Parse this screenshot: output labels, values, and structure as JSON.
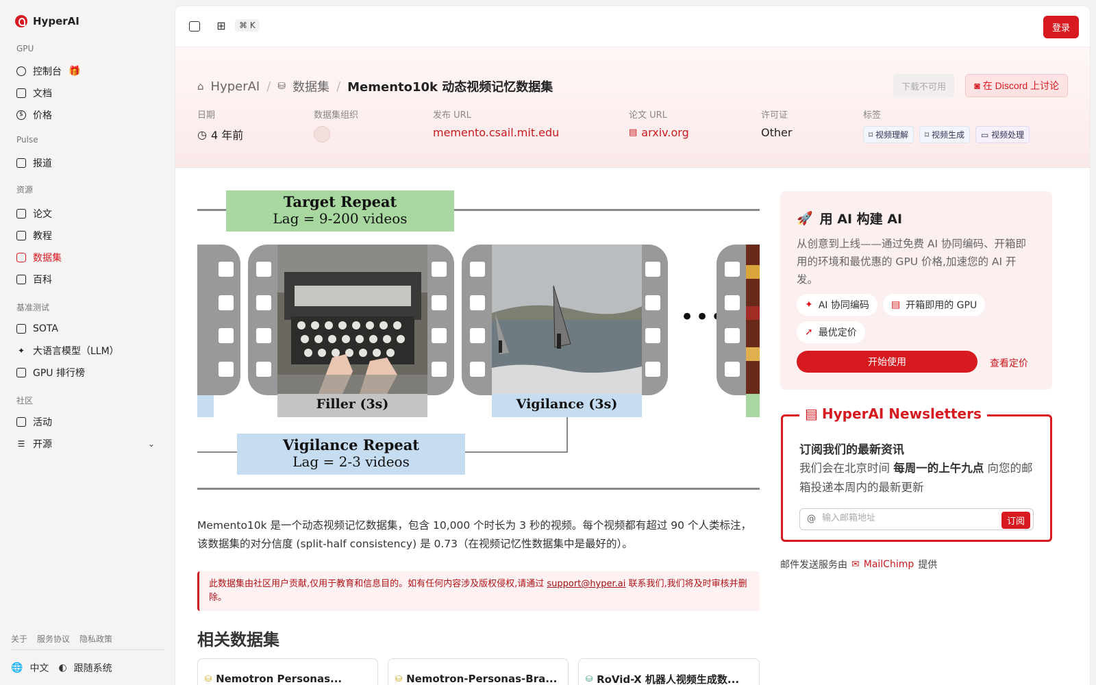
{
  "app": {
    "name": "HyperAI"
  },
  "sidebar": {
    "sections": {
      "gpu": "GPU",
      "pulse": "Pulse",
      "resources": "资源",
      "benchmarks": "基准测试",
      "community": "社区"
    },
    "items": {
      "console": "控制台",
      "docs": "文档",
      "pricing": "价格",
      "reports": "报道",
      "papers": "论文",
      "tutorials": "教程",
      "datasets": "数据集",
      "wiki": "百科",
      "sota": "SOTA",
      "llm": "大语言模型（LLM）",
      "gpu_rank": "GPU 排行榜",
      "events": "活动",
      "open_source": "开源"
    },
    "footer_links": [
      "关于",
      "服务协议",
      "隐私政策"
    ],
    "language": "中文",
    "theme": "跟随系统"
  },
  "topbar": {
    "shortcut": "⌘ K",
    "login": "登录"
  },
  "breadcrumb": {
    "home": "HyperAI",
    "datasets": "数据集",
    "current": "Memento10k 动态视频记忆数据集"
  },
  "actions": {
    "download": "下载不可用",
    "discord": "在 Discord 上讨论"
  },
  "meta": {
    "date_label": "日期",
    "date_value": "4 年前",
    "org_label": "数据集组织",
    "pub_label": "发布 URL",
    "pub_value": "memento.csail.mit.edu",
    "paper_label": "论文 URL",
    "paper_value": "arxiv.org",
    "license_label": "许可证",
    "license_value": "Other",
    "tags_label": "标签",
    "tags": [
      "视频理解",
      "视频生成",
      "视频处理"
    ]
  },
  "figure": {
    "target_title": "Target Repeat",
    "target_lag": "Lag = 9-200 videos",
    "filler": "Filler (3s)",
    "vigilance": "Vigilance (3s)",
    "vig_repeat_title": "Vigilance Repeat",
    "vig_repeat_lag": "Lag = 2-3 videos",
    "ellipsis": "•••"
  },
  "description": "Memento10k 是一个动态视频记忆数据集，包含 10,000 个时长为 3 秒的视频。每个视频都有超过 90 个人类标注，该数据集的对分信度 (split-half consistency) 是 0.73（在视频记忆性数据集中是最好的）。",
  "notice": {
    "before": "此数据集由社区用户贡献,仅用于教育和信息目的。如有任何内容涉及版权侵权,请通过 ",
    "email": "support@hyper.ai",
    "after": " 联系我们,我们将及时审核并删除。"
  },
  "related": {
    "title": "相关数据集",
    "cards": [
      "Nemotron Personas...",
      "Nemotron-Personas-Bra...",
      "RoVid-X 机器人视频生成数..."
    ]
  },
  "promo": {
    "title": "用 AI 构建 AI",
    "text": "从创意到上线——通过免费 AI 协同编码、开箱即用的环境和最优惠的 GPU 价格,加速您的 AI 开发。",
    "chips": [
      "AI 协同编码",
      "开箱即用的 GPU",
      "最优定价"
    ],
    "start": "开始使用",
    "pricing": "查看定价"
  },
  "newsletter": {
    "legend": "HyperAI Newsletters",
    "heading": "订阅我们的最新资讯",
    "text_before": "我们会在北京时间 ",
    "text_bold": "每周一的上午九点",
    "text_after": " 向您的邮箱投递本周内的最新更新",
    "placeholder": "输入邮箱地址",
    "subscribe": "订阅",
    "provider_before": "邮件发送服务由",
    "provider": "MailChimp",
    "provider_after": "提供"
  }
}
